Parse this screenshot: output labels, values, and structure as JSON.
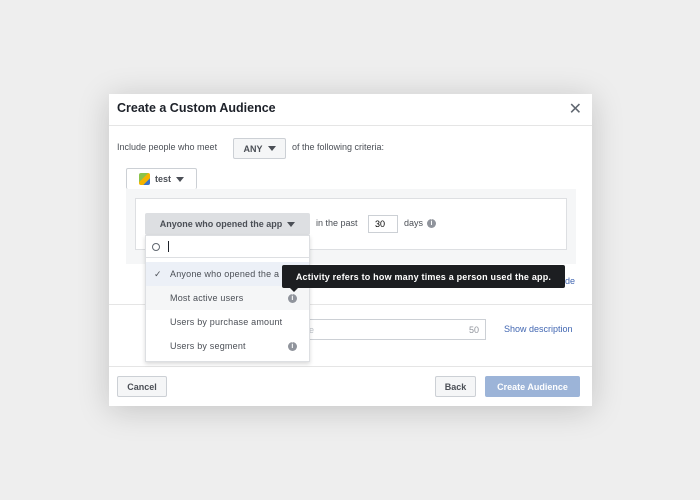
{
  "dialog": {
    "title": "Create a Custom Audience",
    "close_icon": "close-icon"
  },
  "criteria": {
    "prefix": "Include people who meet",
    "match": "ANY",
    "suffix": "of the following criteria:"
  },
  "app": {
    "name": "test",
    "icon": "app-cube-icon"
  },
  "rule": {
    "selected": "Anyone who opened the app",
    "in_past": "in the past",
    "days_value": "30",
    "days_label": "days"
  },
  "search": {
    "value": ""
  },
  "options": [
    {
      "label": "Anyone who opened the app",
      "display": "Anyone who opened the a",
      "selected": true
    },
    {
      "label": "Most active users",
      "info": true
    },
    {
      "label": "Users by purchase amount"
    },
    {
      "label": "Users by segment",
      "info": true
    }
  ],
  "tooltip": "Activity refers to how many times a person used the app.",
  "exclude_link_partial": "de",
  "name_field": {
    "placeholder_partial": "e",
    "counter": "50"
  },
  "show_description": "Show description",
  "footer": {
    "cancel": "Cancel",
    "back": "Back",
    "create": "Create Audience"
  },
  "colors": {
    "primary_disabled": "#9cb4d8",
    "link": "#4267b2",
    "tooltip_bg": "#1c1e21"
  }
}
